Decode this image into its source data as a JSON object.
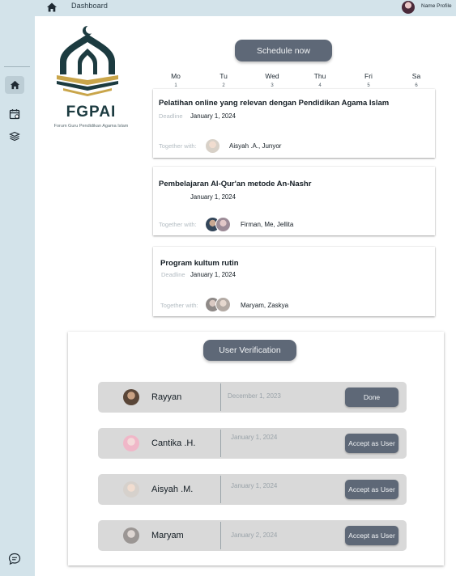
{
  "topbar": {
    "breadcrumb": "Dashboard",
    "profile_name": "Name Profile"
  },
  "sidebar": {
    "items": [
      {
        "icon": "home-icon",
        "active": true
      },
      {
        "icon": "calendar-icon",
        "active": false
      },
      {
        "icon": "books-icon",
        "active": false
      }
    ],
    "bottom_icon": "chat-icon"
  },
  "logo": {
    "title": "FGPAI",
    "subtitle": "Forum Guru Pendidikan Agama Islam"
  },
  "schedule": {
    "button_label": "Schedule now",
    "days": [
      {
        "name": "Mo",
        "num": "1"
      },
      {
        "name": "Tu",
        "num": "2"
      },
      {
        "name": "Wed",
        "num": "3"
      },
      {
        "name": "Thu",
        "num": "4"
      },
      {
        "name": "Fri",
        "num": "5"
      },
      {
        "name": "Sa",
        "num": "6"
      }
    ],
    "events": [
      {
        "title": "Pelatihan online yang relevan dengan Pendidikan Agama Islam",
        "deadline_label": "Deadline",
        "date": "January 1, 2024",
        "together_label": "Together with:",
        "members": "Aisyah .A., Junyor"
      },
      {
        "title": "Pembelajaran Al-Qur'an metode An-Nashr",
        "deadline_label": "",
        "date": "January 1, 2024",
        "together_label": "Together with:",
        "members": "Firman, Me, Jellita"
      },
      {
        "title": "Program kultum rutin",
        "deadline_label": "Deadline",
        "date": "January 1, 2024",
        "together_label": "Together with:",
        "members": "Maryam, Zaskya"
      }
    ]
  },
  "verification": {
    "button_label": "User Verification",
    "users": [
      {
        "name": "Rayyan",
        "date": "December 1, 2023",
        "action": "Done"
      },
      {
        "name": "Cantika .H.",
        "date": "January 1, 2024",
        "action": "Accept as User"
      },
      {
        "name": "Aisyah .M.",
        "date": "January 1, 2024",
        "action": "Accept as User"
      },
      {
        "name": "Maryam",
        "date": "January 2, 2024",
        "action": "Accept as User"
      }
    ]
  },
  "colors": {
    "sidebar_bg": "#d3e3ea",
    "button_bg": "#5e6877",
    "row_bg": "#d9d9d9",
    "logo_teal": "#1c3b40",
    "logo_gold": "#c9a54a"
  }
}
